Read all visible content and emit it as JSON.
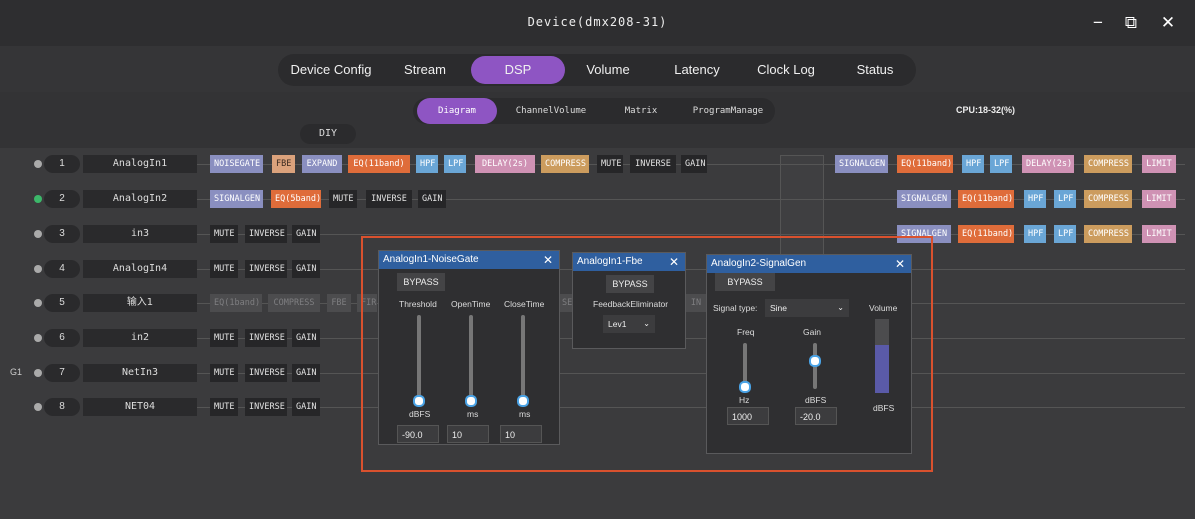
{
  "window": {
    "title": "Device(dmx208-31)",
    "minimize": "−",
    "restore": "⧉",
    "close": "✕"
  },
  "tabs": [
    "Device Config",
    "Stream",
    "DSP",
    "Volume",
    "Latency",
    "Clock Log",
    "Status"
  ],
  "active_tab": "DSP",
  "subtabs": [
    "Diagram",
    "ChannelVolume",
    "Matrix",
    "ProgramManage"
  ],
  "active_subtab": "Diagram",
  "cpu": "CPU:18-32(%)",
  "diy": "DIY",
  "channels": [
    {
      "num": "1",
      "name": "AnalogIn1",
      "group": "",
      "dot": "gray"
    },
    {
      "num": "2",
      "name": "AnalogIn2",
      "group": "",
      "dot": "green"
    },
    {
      "num": "3",
      "name": "in3",
      "group": "",
      "dot": "gray"
    },
    {
      "num": "4",
      "name": "AnalogIn4",
      "group": "",
      "dot": "gray"
    },
    {
      "num": "5",
      "name": "输入1",
      "group": "",
      "dot": "gray"
    },
    {
      "num": "6",
      "name": "in2",
      "group": "",
      "dot": "gray"
    },
    {
      "num": "7",
      "name": "NetIn3",
      "group": "G1",
      "dot": "gray"
    },
    {
      "num": "8",
      "name": "NET04",
      "group": "",
      "dot": "gray"
    }
  ],
  "blocks": {
    "r1": [
      "NOISEGATE",
      "FBE",
      "EXPAND",
      "EQ(11band)",
      "HPF",
      "LPF",
      "DELAY(2s)",
      "COMPRESS",
      "MUTE",
      "INVERSE",
      "GAIN"
    ],
    "r2": [
      "SIGNALGEN",
      "EQ(5band)",
      "MUTE",
      "INVERSE",
      "GAIN"
    ],
    "basic": [
      "MUTE",
      "INVERSE",
      "GAIN"
    ],
    "r5": [
      "EQ(1band)",
      "COMPRESS",
      "FBE",
      "FIR",
      "SEG",
      "IN"
    ],
    "out1": [
      "SIGNALGEN",
      "EQ(11band)",
      "HPF",
      "LPF",
      "DELAY(2s)",
      "COMPRESS",
      "LIMIT"
    ],
    "out2": [
      "SIGNALGEN",
      "EQ(11band)",
      "HPF",
      "LPF",
      "COMPRESS",
      "LIMIT"
    ],
    "out3": [
      "SIGNALGEN",
      "EQ(11band)",
      "HPF",
      "LPF",
      "COMPRESS",
      "LIMIT"
    ]
  },
  "dialogs": {
    "noisegate": {
      "title": "AnalogIn1-NoiseGate",
      "close": "✕",
      "bypass": "BYPASS",
      "labels": [
        "Threshold",
        "OpenTime",
        "CloseTime"
      ],
      "units": [
        "dBFS",
        "ms",
        "ms"
      ],
      "values": [
        "-90.0",
        "10",
        "10"
      ]
    },
    "fbe": {
      "title": "AnalogIn1-Fbe",
      "close": "✕",
      "bypass": "BYPASS",
      "label": "FeedbackEliminator",
      "level": "Lev1"
    },
    "signalgen": {
      "title": "AnalogIn2-SignalGen",
      "close": "✕",
      "bypass": "BYPASS",
      "signal_type_label": "Signal type:",
      "signal_type": "Sine",
      "volume_label": "Volume",
      "volume_unit": "dBFS",
      "freq_label": "Freq",
      "freq_unit": "Hz",
      "freq_value": "1000",
      "gain_label": "Gain",
      "gain_unit": "dBFS",
      "gain_value": "-20.0"
    }
  }
}
